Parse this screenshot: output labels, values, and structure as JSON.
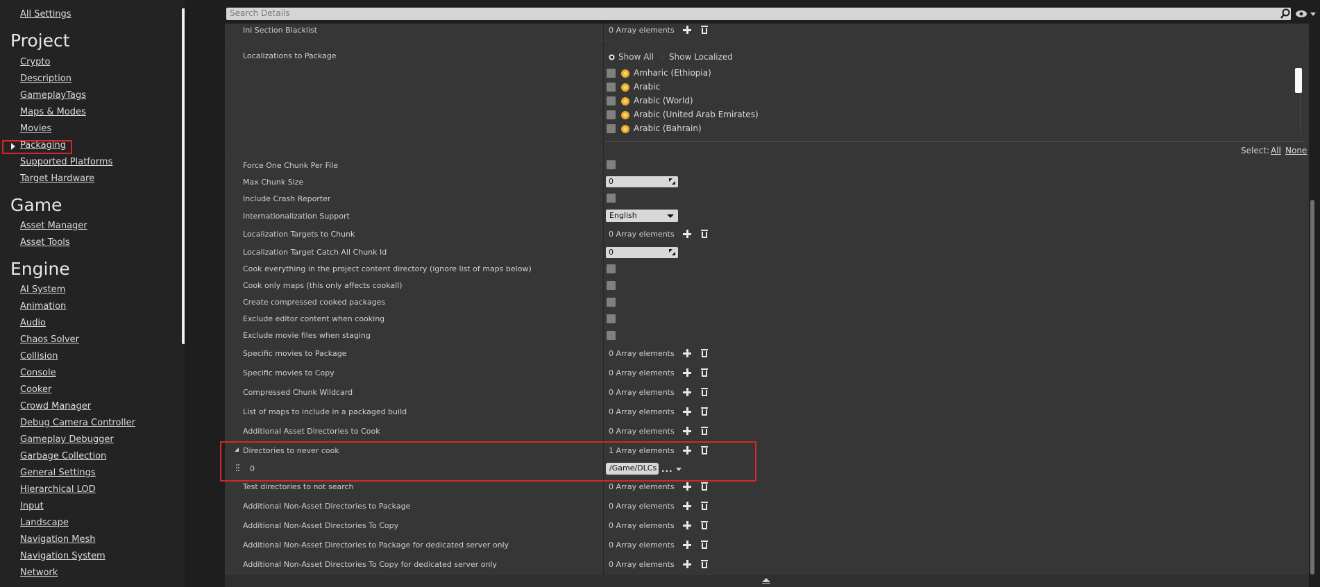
{
  "sidebar": {
    "all_settings": "All Settings",
    "sections": [
      {
        "title": "Project",
        "items": [
          "Crypto",
          "Description",
          "GameplayTags",
          "Maps & Modes",
          "Movies",
          "Packaging",
          "Supported Platforms",
          "Target Hardware"
        ]
      },
      {
        "title": "Game",
        "items": [
          "Asset Manager",
          "Asset Tools"
        ]
      },
      {
        "title": "Engine",
        "items": [
          "AI System",
          "Animation",
          "Audio",
          "Chaos Solver",
          "Collision",
          "Console",
          "Cooker",
          "Crowd Manager",
          "Debug Camera Controller",
          "Gameplay Debugger",
          "Garbage Collection",
          "General Settings",
          "Hierarchical LOD",
          "Input",
          "Landscape",
          "Navigation Mesh",
          "Navigation System",
          "Network"
        ]
      }
    ],
    "selected_item": "Packaging"
  },
  "search": {
    "placeholder": "Search Details"
  },
  "localizations": {
    "label": "Localizations to Package",
    "show_all": "Show All",
    "show_localized": "Show Localized",
    "languages": [
      "Amharic (Ethiopia)",
      "Arabic",
      "Arabic (World)",
      "Arabic (United Arab Emirates)",
      "Arabic (Bahrain)"
    ],
    "select_label": "Select:",
    "select_all": "All",
    "select_none": "None"
  },
  "ini_section": {
    "label": "Ini Section Blacklist",
    "value": "0 Array elements"
  },
  "rows": {
    "force_one_chunk": "Force One Chunk Per File",
    "max_chunk_size": "Max Chunk Size",
    "max_chunk_size_value": "0",
    "include_crash_reporter": "Include Crash Reporter",
    "internationalization": "Internationalization Support",
    "internationalization_value": "English",
    "loc_targets_chunk": "Localization Targets to Chunk",
    "loc_targets_chunk_value": "0 Array elements",
    "loc_catch_all": "Localization Target Catch All Chunk Id",
    "loc_catch_all_value": "0",
    "cook_everything": "Cook everything in the project content directory (ignore list of maps below)",
    "cook_only_maps": "Cook only maps (this only affects cookall)",
    "create_compressed": "Create compressed cooked packages",
    "exclude_editor": "Exclude editor content when cooking",
    "exclude_movie": "Exclude movie files when staging",
    "specific_movies_package": "Specific movies to Package",
    "specific_movies_copy": "Specific movies to Copy",
    "compressed_chunk_wildcard": "Compressed Chunk Wildcard",
    "list_of_maps": "List of maps to include in a packaged build",
    "additional_asset_dirs": "Additional Asset Directories to Cook",
    "dirs_never_cook": "Directories to never cook",
    "dirs_never_cook_value": "1 Array elements",
    "dirs_never_cook_index": "0",
    "dirs_never_cook_path": "/Game/DLCs",
    "browse": "...",
    "test_dirs": "Test directories to not search",
    "addl_nonasset_package": "Additional Non-Asset Directories to Package",
    "addl_nonasset_copy": "Additional Non-Asset Directories To Copy",
    "addl_nonasset_package_server": "Additional Non-Asset Directories to Package for dedicated server only",
    "addl_nonasset_copy_server": "Additional Non-Asset Directories To Copy for dedicated server only",
    "zero_array": "0 Array elements"
  },
  "colors": {
    "highlight": "#d42828",
    "panel": "#363636",
    "sidebar": "#232323"
  }
}
